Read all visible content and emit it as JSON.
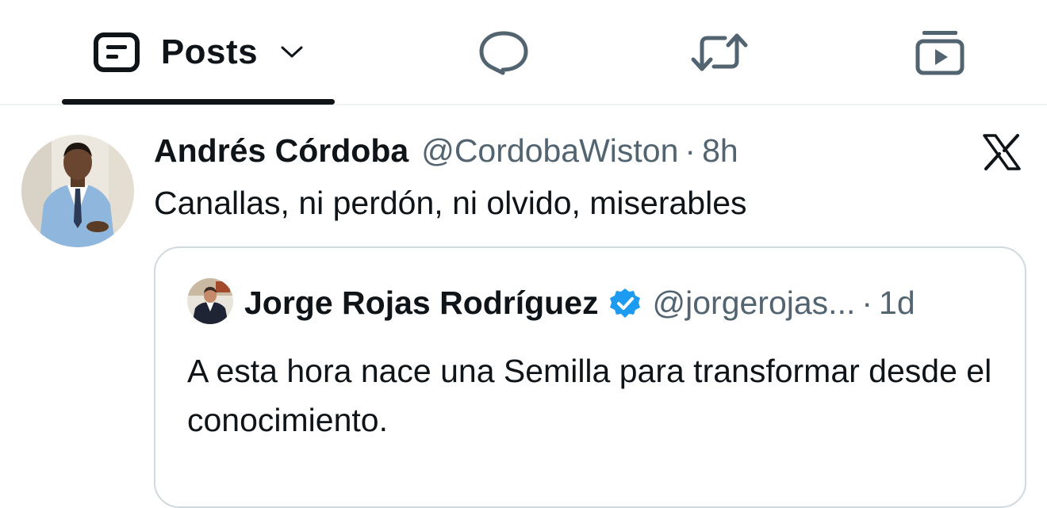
{
  "tabs": {
    "posts_label": "Posts",
    "items": [
      {
        "name": "posts",
        "icon": "posts-icon",
        "active": true
      },
      {
        "name": "replies",
        "icon": "reply-bubble-icon",
        "active": false
      },
      {
        "name": "reposts",
        "icon": "repost-icon",
        "active": false
      },
      {
        "name": "videos",
        "icon": "video-icon",
        "active": false
      }
    ]
  },
  "post": {
    "author_name": "Andrés Córdoba",
    "author_handle": "@CordobaWiston",
    "separator": "·",
    "time": "8h",
    "text": "Canallas, ni perdón, ni olvido, miserables",
    "brand_icon": "x-logo-icon"
  },
  "quote": {
    "author_name": "Jorge Rojas Rodríguez",
    "verified": true,
    "author_handle": "@jorgerojas...",
    "separator": "·",
    "time": "1d",
    "text": "A esta hora nace una Semilla para transformar desde el conocimiento."
  },
  "colors": {
    "text_primary": "#0f1419",
    "text_secondary": "#536471",
    "border": "#cfd9de",
    "divider": "#eff3f4",
    "verified_blue": "#1d9bf0"
  }
}
